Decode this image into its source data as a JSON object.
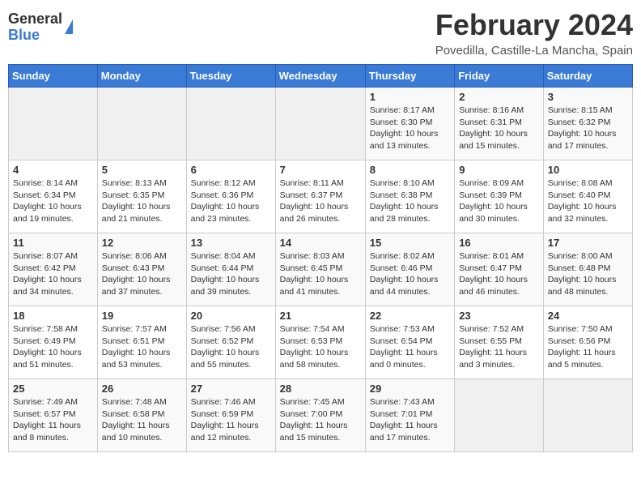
{
  "logo": {
    "general": "General",
    "blue": "Blue"
  },
  "title": "February 2024",
  "location": "Povedilla, Castille-La Mancha, Spain",
  "days_of_week": [
    "Sunday",
    "Monday",
    "Tuesday",
    "Wednesday",
    "Thursday",
    "Friday",
    "Saturday"
  ],
  "weeks": [
    [
      {
        "day": "",
        "info": ""
      },
      {
        "day": "",
        "info": ""
      },
      {
        "day": "",
        "info": ""
      },
      {
        "day": "",
        "info": ""
      },
      {
        "day": "1",
        "info": "Sunrise: 8:17 AM\nSunset: 6:30 PM\nDaylight: 10 hours and 13 minutes."
      },
      {
        "day": "2",
        "info": "Sunrise: 8:16 AM\nSunset: 6:31 PM\nDaylight: 10 hours and 15 minutes."
      },
      {
        "day": "3",
        "info": "Sunrise: 8:15 AM\nSunset: 6:32 PM\nDaylight: 10 hours and 17 minutes."
      }
    ],
    [
      {
        "day": "4",
        "info": "Sunrise: 8:14 AM\nSunset: 6:34 PM\nDaylight: 10 hours and 19 minutes."
      },
      {
        "day": "5",
        "info": "Sunrise: 8:13 AM\nSunset: 6:35 PM\nDaylight: 10 hours and 21 minutes."
      },
      {
        "day": "6",
        "info": "Sunrise: 8:12 AM\nSunset: 6:36 PM\nDaylight: 10 hours and 23 minutes."
      },
      {
        "day": "7",
        "info": "Sunrise: 8:11 AM\nSunset: 6:37 PM\nDaylight: 10 hours and 26 minutes."
      },
      {
        "day": "8",
        "info": "Sunrise: 8:10 AM\nSunset: 6:38 PM\nDaylight: 10 hours and 28 minutes."
      },
      {
        "day": "9",
        "info": "Sunrise: 8:09 AM\nSunset: 6:39 PM\nDaylight: 10 hours and 30 minutes."
      },
      {
        "day": "10",
        "info": "Sunrise: 8:08 AM\nSunset: 6:40 PM\nDaylight: 10 hours and 32 minutes."
      }
    ],
    [
      {
        "day": "11",
        "info": "Sunrise: 8:07 AM\nSunset: 6:42 PM\nDaylight: 10 hours and 34 minutes."
      },
      {
        "day": "12",
        "info": "Sunrise: 8:06 AM\nSunset: 6:43 PM\nDaylight: 10 hours and 37 minutes."
      },
      {
        "day": "13",
        "info": "Sunrise: 8:04 AM\nSunset: 6:44 PM\nDaylight: 10 hours and 39 minutes."
      },
      {
        "day": "14",
        "info": "Sunrise: 8:03 AM\nSunset: 6:45 PM\nDaylight: 10 hours and 41 minutes."
      },
      {
        "day": "15",
        "info": "Sunrise: 8:02 AM\nSunset: 6:46 PM\nDaylight: 10 hours and 44 minutes."
      },
      {
        "day": "16",
        "info": "Sunrise: 8:01 AM\nSunset: 6:47 PM\nDaylight: 10 hours and 46 minutes."
      },
      {
        "day": "17",
        "info": "Sunrise: 8:00 AM\nSunset: 6:48 PM\nDaylight: 10 hours and 48 minutes."
      }
    ],
    [
      {
        "day": "18",
        "info": "Sunrise: 7:58 AM\nSunset: 6:49 PM\nDaylight: 10 hours and 51 minutes."
      },
      {
        "day": "19",
        "info": "Sunrise: 7:57 AM\nSunset: 6:51 PM\nDaylight: 10 hours and 53 minutes."
      },
      {
        "day": "20",
        "info": "Sunrise: 7:56 AM\nSunset: 6:52 PM\nDaylight: 10 hours and 55 minutes."
      },
      {
        "day": "21",
        "info": "Sunrise: 7:54 AM\nSunset: 6:53 PM\nDaylight: 10 hours and 58 minutes."
      },
      {
        "day": "22",
        "info": "Sunrise: 7:53 AM\nSunset: 6:54 PM\nDaylight: 11 hours and 0 minutes."
      },
      {
        "day": "23",
        "info": "Sunrise: 7:52 AM\nSunset: 6:55 PM\nDaylight: 11 hours and 3 minutes."
      },
      {
        "day": "24",
        "info": "Sunrise: 7:50 AM\nSunset: 6:56 PM\nDaylight: 11 hours and 5 minutes."
      }
    ],
    [
      {
        "day": "25",
        "info": "Sunrise: 7:49 AM\nSunset: 6:57 PM\nDaylight: 11 hours and 8 minutes."
      },
      {
        "day": "26",
        "info": "Sunrise: 7:48 AM\nSunset: 6:58 PM\nDaylight: 11 hours and 10 minutes."
      },
      {
        "day": "27",
        "info": "Sunrise: 7:46 AM\nSunset: 6:59 PM\nDaylight: 11 hours and 12 minutes."
      },
      {
        "day": "28",
        "info": "Sunrise: 7:45 AM\nSunset: 7:00 PM\nDaylight: 11 hours and 15 minutes."
      },
      {
        "day": "29",
        "info": "Sunrise: 7:43 AM\nSunset: 7:01 PM\nDaylight: 11 hours and 17 minutes."
      },
      {
        "day": "",
        "info": ""
      },
      {
        "day": "",
        "info": ""
      }
    ]
  ]
}
